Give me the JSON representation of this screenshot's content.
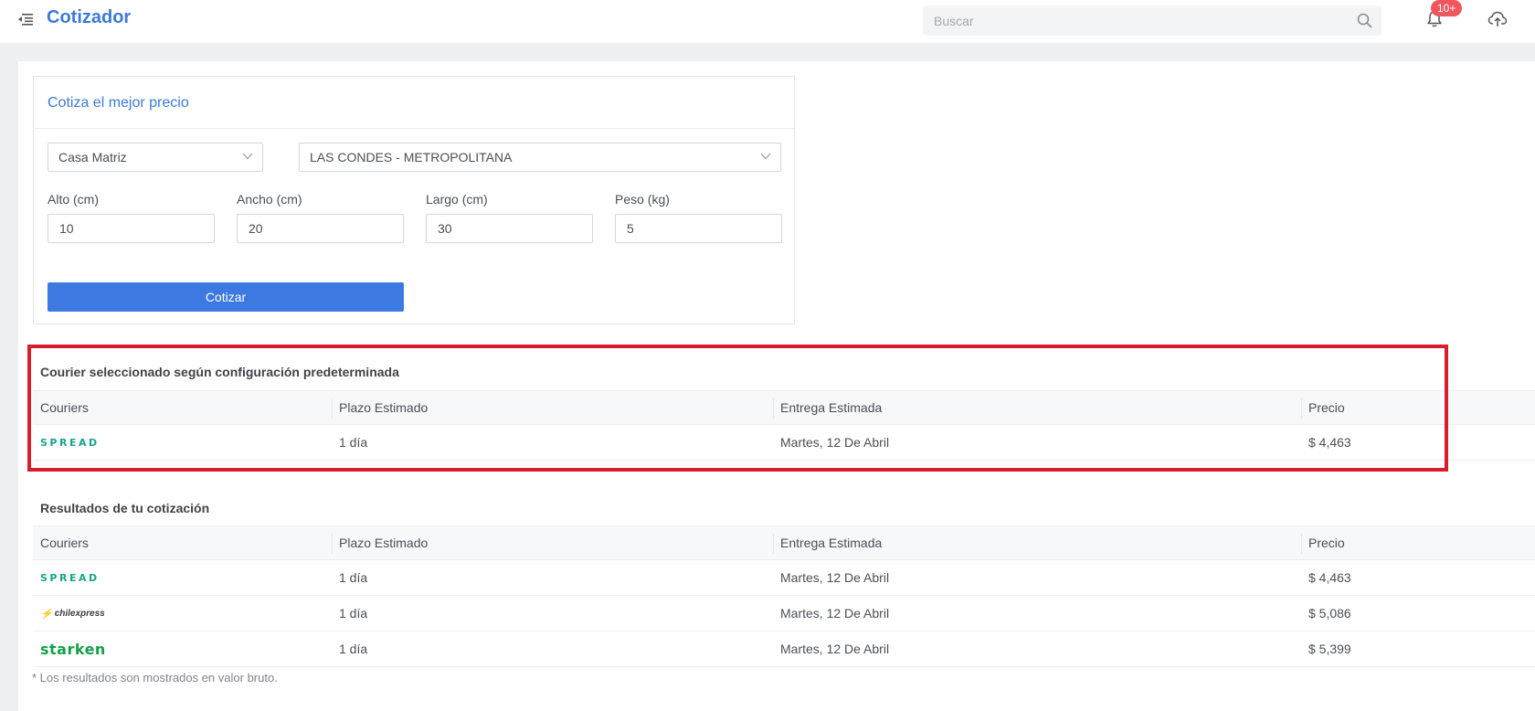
{
  "header": {
    "title": "Cotizador",
    "search_placeholder": "Buscar",
    "notification_badge": "10+"
  },
  "quote_form": {
    "title": "Cotiza el mejor precio",
    "origin_select": "Casa Matriz",
    "destination_select": "LAS CONDES - METROPOLITANA",
    "fields": [
      {
        "label": "Alto (cm)",
        "value": "10"
      },
      {
        "label": "Ancho (cm)",
        "value": "20"
      },
      {
        "label": "Largo (cm)",
        "value": "30"
      },
      {
        "label": "Peso (kg)",
        "value": "5"
      }
    ],
    "submit_label": "Cotizar"
  },
  "columns": [
    "Couriers",
    "Plazo Estimado",
    "Entrega Estimada",
    "Precio"
  ],
  "selected_section": {
    "title": "Courier seleccionado según configuración predeterminada",
    "rows": [
      {
        "courier": "SPREAD",
        "plazo": "1 día",
        "entrega": "Martes, 12 De Abril",
        "precio": "$ 4,463"
      }
    ]
  },
  "results_section": {
    "title": "Resultados de tu cotización",
    "rows": [
      {
        "courier": "SPREAD",
        "plazo": "1 día",
        "entrega": "Martes, 12 De Abril",
        "precio": "$ 4,463"
      },
      {
        "courier": "chilexpress",
        "plazo": "1 día",
        "entrega": "Martes, 12 De Abril",
        "precio": "$ 5,086"
      },
      {
        "courier": "starken",
        "plazo": "1 día",
        "entrega": "Martes, 12 De Abril",
        "precio": "$ 5,399"
      }
    ]
  },
  "footnote": "* Los resultados son mostrados en valor bruto.",
  "icons": {
    "menu": "menu-fold-icon",
    "search": "search-icon",
    "bell": "bell-icon",
    "cloud": "cloud-upload-icon"
  },
  "colors": {
    "accent": "#3c79d8",
    "button": "#3c79e0",
    "highlight_border": "#d81e2c",
    "badge": "#f0565d",
    "spread_logo": "#17a58a",
    "starken_logo": "#13a04a"
  }
}
